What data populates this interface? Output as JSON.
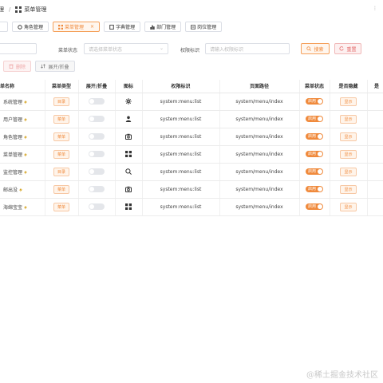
{
  "breadcrumb": {
    "parent": "理",
    "current": "菜单管理"
  },
  "tabs": [
    {
      "label": "",
      "active": false
    },
    {
      "label": "角色管理",
      "active": false,
      "icon": "role-icon"
    },
    {
      "label": "菜单管理",
      "active": true,
      "icon": "menu-grid-icon"
    },
    {
      "label": "字典管理",
      "active": false,
      "icon": "book-icon"
    },
    {
      "label": "部门管理",
      "active": false,
      "icon": "bar-chart-icon"
    },
    {
      "label": "岗位管理",
      "active": false,
      "icon": "post-icon"
    }
  ],
  "filters": {
    "menu_status_label": "菜单状态",
    "menu_status_placeholder": "请选择菜单状态",
    "perm_label": "权限标识",
    "perm_placeholder": "请输入权限标识",
    "search_label": "搜索",
    "reset_label": "重置"
  },
  "actions": {
    "delete_label": "删除",
    "expand_label": "展开/折叠"
  },
  "table": {
    "headers": [
      "单名称",
      "菜单类型",
      "展开/折叠",
      "图标",
      "权限标识",
      "页面路径",
      "菜单状态",
      "是否隐藏",
      "是"
    ],
    "rows": [
      {
        "name": "系统管理",
        "type": "目录",
        "icon": "gear-icon",
        "perm": "system:menu:list",
        "path": "system/menu/index",
        "status": "启用",
        "hidden": "显示"
      },
      {
        "name": "用户管理",
        "type": "菜单",
        "icon": "user-icon",
        "perm": "system:menu:list",
        "path": "system/menu/index",
        "status": "启用",
        "hidden": "显示"
      },
      {
        "name": "角色管理",
        "type": "菜单",
        "icon": "camera-icon",
        "perm": "system:menu:list",
        "path": "system/menu/index",
        "status": "启用",
        "hidden": "显示"
      },
      {
        "name": "菜单管理",
        "type": "菜单",
        "icon": "grid-icon",
        "perm": "system:menu:list",
        "path": "system/menu/index",
        "status": "启用",
        "hidden": "显示"
      },
      {
        "name": "监控管理",
        "type": "目录",
        "icon": "search-icon",
        "perm": "system:menu:list",
        "path": "system/menu/index",
        "status": "启用",
        "hidden": "显示"
      },
      {
        "name": "邮出没",
        "type": "菜单",
        "icon": "camera-icon",
        "perm": "system:menu:list",
        "path": "system/menu/index",
        "status": "启用",
        "hidden": "显示"
      },
      {
        "name": "海绵宝宝",
        "type": "菜单",
        "icon": "grid-icon",
        "perm": "system:menu:list",
        "path": "system/menu/index",
        "status": "启用",
        "hidden": "显示"
      }
    ]
  },
  "watermark": "@稀土掘金技术社区",
  "colors": {
    "accent": "#f08a3c",
    "danger": "#e36a6a"
  }
}
